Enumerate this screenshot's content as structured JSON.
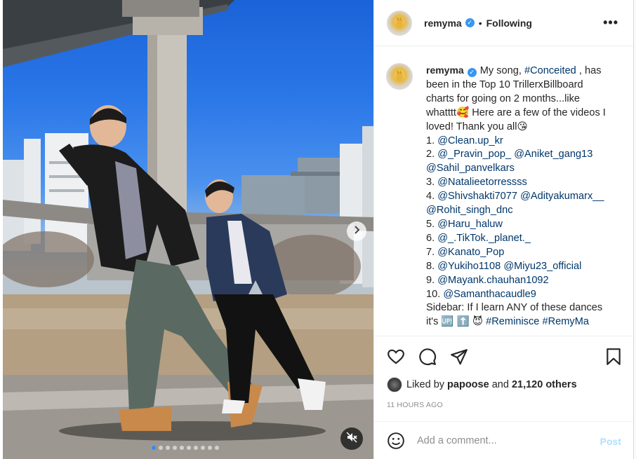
{
  "post": {
    "username": "remyma",
    "verified": true,
    "follow_state": "Following",
    "more_icon": "more-options-icon"
  },
  "caption": {
    "lines": [
      {
        "parts": [
          {
            "t": "My song, "
          },
          {
            "t": "#Conceited",
            "tag": true
          },
          {
            "t": " , has"
          }
        ]
      },
      {
        "parts": [
          {
            "t": "been in the Top 10 TrillerxBillboard"
          }
        ]
      },
      {
        "parts": [
          {
            "t": "charts for going on 2 months...like"
          }
        ]
      },
      {
        "parts": [
          {
            "t": "whatttt🥰 Here are a few of the videos I"
          }
        ]
      },
      {
        "parts": [
          {
            "t": "loved! Thank you all😘"
          }
        ]
      },
      {
        "parts": [
          {
            "t": "1. "
          },
          {
            "t": "@Clean.up_kr",
            "tag": true
          }
        ]
      },
      {
        "parts": [
          {
            "t": "2. "
          },
          {
            "t": "@_Pravin_pop_",
            "tag": true
          },
          {
            "t": " "
          },
          {
            "t": "@Aniket_gang13",
            "tag": true
          }
        ]
      },
      {
        "parts": [
          {
            "t": "@Sahil_panvelkars",
            "tag": true
          }
        ]
      },
      {
        "parts": [
          {
            "t": "3. "
          },
          {
            "t": "@Natalieetorressss",
            "tag": true
          }
        ]
      },
      {
        "parts": [
          {
            "t": "4. "
          },
          {
            "t": "@Shivshakti7077",
            "tag": true
          },
          {
            "t": " "
          },
          {
            "t": "@Adityakumarx__",
            "tag": true
          }
        ]
      },
      {
        "parts": [
          {
            "t": "@Rohit_singh_dnc",
            "tag": true
          }
        ]
      },
      {
        "parts": [
          {
            "t": "5. "
          },
          {
            "t": "@Haru_haluw",
            "tag": true
          }
        ]
      },
      {
        "parts": [
          {
            "t": "6. "
          },
          {
            "t": "@_.TikTok._planet._",
            "tag": true
          }
        ]
      },
      {
        "parts": [
          {
            "t": "7. "
          },
          {
            "t": "@Kanato_Pop",
            "tag": true
          }
        ]
      },
      {
        "parts": [
          {
            "t": "8. "
          },
          {
            "t": "@Yukiho1108",
            "tag": true
          },
          {
            "t": " "
          },
          {
            "t": "@Miyu23_official",
            "tag": true
          }
        ]
      },
      {
        "parts": [
          {
            "t": "9. "
          },
          {
            "t": "@Mayank.chauhan1092",
            "tag": true
          }
        ]
      },
      {
        "parts": [
          {
            "t": "10. "
          },
          {
            "t": "@Samanthacaudle9",
            "tag": true
          }
        ]
      },
      {
        "parts": [
          {
            "t": "Sidebar: If I learn ANY of these dances"
          }
        ]
      },
      {
        "parts": [
          {
            "t": "it's 🆙 ⬆️ 😈 "
          },
          {
            "t": "#Reminisce",
            "tag": true
          },
          {
            "t": " "
          },
          {
            "t": "#RemyMa",
            "tag": true
          }
        ]
      }
    ]
  },
  "actions": {
    "like_icon": "heart-icon",
    "comment_icon": "comment-icon",
    "share_icon": "share-icon",
    "save_icon": "bookmark-icon"
  },
  "likes": {
    "prefix": "Liked by",
    "user": "papoose",
    "middle": "and",
    "count": "21,120 others"
  },
  "timestamp": "11 HOURS AGO",
  "comment": {
    "placeholder": "Add a comment...",
    "post_label": "Post",
    "post_color": "#b2dffc",
    "emoji_icon": "emoji-icon"
  },
  "media": {
    "next_icon": "chevron-right-icon",
    "mute_icon": "mute-icon",
    "carousel_count": 10,
    "carousel_active": 1
  },
  "colors": {
    "accent": "#0095f6",
    "verified": "#3897f0",
    "tag": "#00376b",
    "muted_text": "#8e8e8e"
  }
}
